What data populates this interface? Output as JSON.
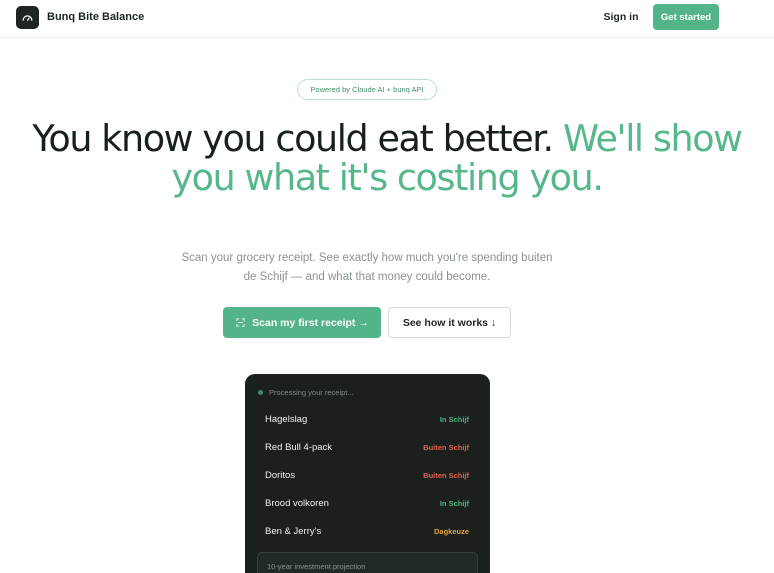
{
  "header": {
    "brand": "Bunq Bite Balance",
    "logo_icon": "gauge-icon",
    "sign_in": "Sign in",
    "get_started": "Get started"
  },
  "hero": {
    "badge": "Powered by Claude AI + bunq API",
    "title_dark": "You know you could eat better.",
    "title_accent": "We'll show you what it's costing you.",
    "subtitle": "Scan your grocery receipt. See exactly how much you're spending buiten de Schijf — and what that money could become.",
    "scan_button": "Scan my first receipt →",
    "scan_icon": "scan-icon",
    "how_button": "See how it works ↓"
  },
  "receipt": {
    "status": "Processing your receipt...",
    "items": [
      {
        "name": "Hagelslag",
        "tag": "In Schijf",
        "color": "#4fb382"
      },
      {
        "name": "Red Bull 4-pack",
        "tag": "Buiten Schijf",
        "color": "#e2614c"
      },
      {
        "name": "Doritos",
        "tag": "Buiten Schijf",
        "color": "#e2614c"
      },
      {
        "name": "Brood volkoren",
        "tag": "In Schijf",
        "color": "#4fb382"
      },
      {
        "name": "Ben & Jerry's",
        "tag": "Dagkeuze",
        "color": "#e3a23b"
      }
    ],
    "projection_label": "10-year investment projection"
  },
  "colors": {
    "accent": "#52b488",
    "card_bg": "#1b201f",
    "in_schijf": "#4fb382",
    "buiten_schijf": "#e2614c",
    "dagkeuze": "#e3a23b"
  }
}
